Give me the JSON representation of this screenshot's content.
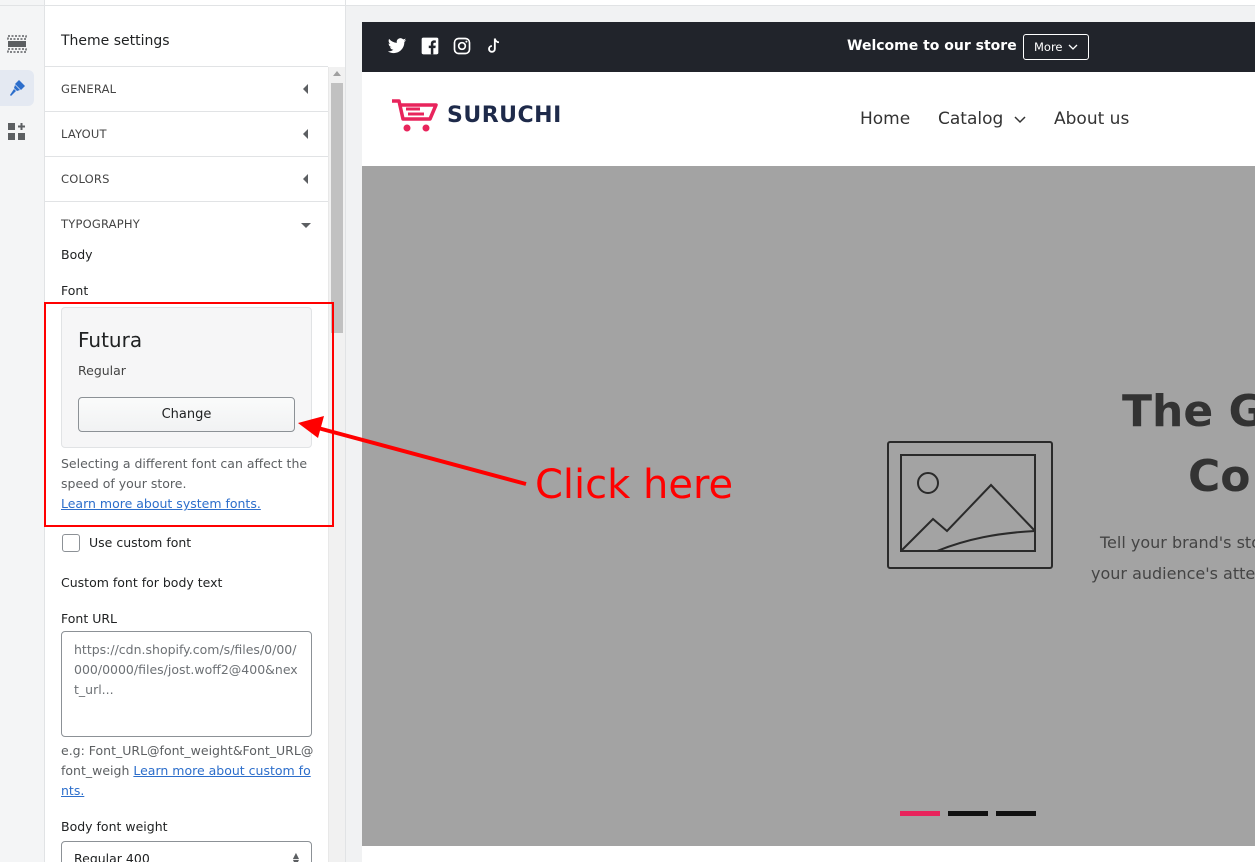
{
  "sidebar": {
    "title": "Theme settings",
    "sections": [
      {
        "label": "GENERAL",
        "expanded": false
      },
      {
        "label": "LAYOUT",
        "expanded": false
      },
      {
        "label": "COLORS",
        "expanded": false
      },
      {
        "label": "TYPOGRAPHY",
        "expanded": true
      }
    ],
    "typography": {
      "body_heading": "Body",
      "font_label": "Font",
      "font_name": "Futura",
      "font_style": "Regular",
      "change_label": "Change",
      "help_text": "Selecting a different font can affect the speed of your store.",
      "help_link": "Learn more about system fonts.",
      "custom_font_checkbox": "Use custom font",
      "custom_font_heading": "Custom font for body text",
      "font_url_label": "Font URL",
      "font_url_placeholder": "https://cdn.shopify.com/s/files/0/00/000/0000/files/jost.woff2@400&next_url...",
      "eg_text": "e.g: Font_URL@font_weight&Font_URL@font_weigh",
      "eg_link": "Learn more about custom fonts.",
      "weight_label": "Body font weight",
      "weight_value": "Regular 400"
    }
  },
  "rail_icons": [
    "sections-icon",
    "theme-brush-icon",
    "apps-icon"
  ],
  "preview": {
    "announcement": {
      "text": "Welcome to our store",
      "more_label": "More"
    },
    "social_icons": [
      "twitter-icon",
      "facebook-icon",
      "instagram-icon",
      "tiktok-icon"
    ],
    "brand": "SURUCHI",
    "nav": [
      "Home",
      "Catalog",
      "About us"
    ],
    "hero": {
      "title_line1": "The G",
      "title_line2": "Co",
      "sub_line1": "Tell your brand's sto",
      "sub_line2": "your audience's atten"
    },
    "slides": 3,
    "active_slide": 1
  },
  "annotation": {
    "text": "Click here",
    "color": "#ff0000"
  },
  "colors": {
    "accent_link": "#2c6ecb",
    "brand_pink": "#e8245c",
    "announce_bg": "#21242b",
    "hero_bg": "#a3a3a3"
  }
}
